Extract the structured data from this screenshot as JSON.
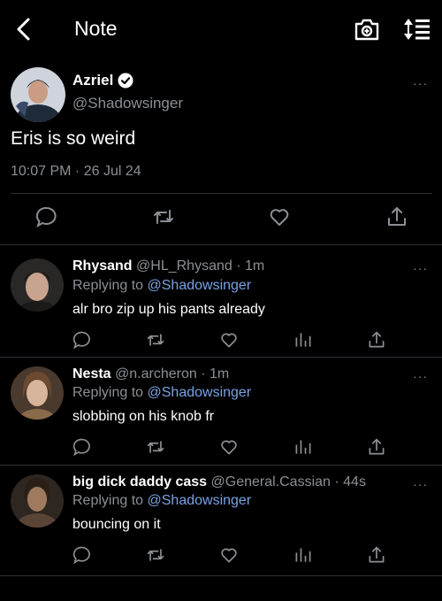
{
  "header": {
    "title": "Note",
    "back_icon": "chevron-left-icon",
    "camera_icon": "camera-icon",
    "sort_icon": "sort-icon"
  },
  "main_post": {
    "name": "Azriel",
    "handle": "@Shadowsinger",
    "text": "Eris is so weird",
    "timestamp": "10:07 PM · 26 Jul 24",
    "more": "···"
  },
  "replies": [
    {
      "name": "Rhysand",
      "meta": "@HL_Rhysand · 1m",
      "replying_prefix": "Replying to",
      "replying_to": "@Shadowsinger",
      "text": "alr bro zip up his pants already",
      "more": "···"
    },
    {
      "name": "Nesta",
      "meta": "@n.archeron · 1m",
      "replying_prefix": "Replying to",
      "replying_to": "@Shadowsinger",
      "text": "slobbing on his knob fr",
      "more": "···"
    },
    {
      "name": "big dick daddy cass",
      "meta": "@General.Cassian · 44s",
      "replying_prefix": "Replying to",
      "replying_to": "@Shadowsinger",
      "text": "bouncing on it",
      "more": "···"
    }
  ],
  "colors": {
    "background": "#000000",
    "text": "#e7e9ea",
    "muted": "#8b8f94",
    "link": "#7aa2e3",
    "divider": "#2f3336"
  }
}
